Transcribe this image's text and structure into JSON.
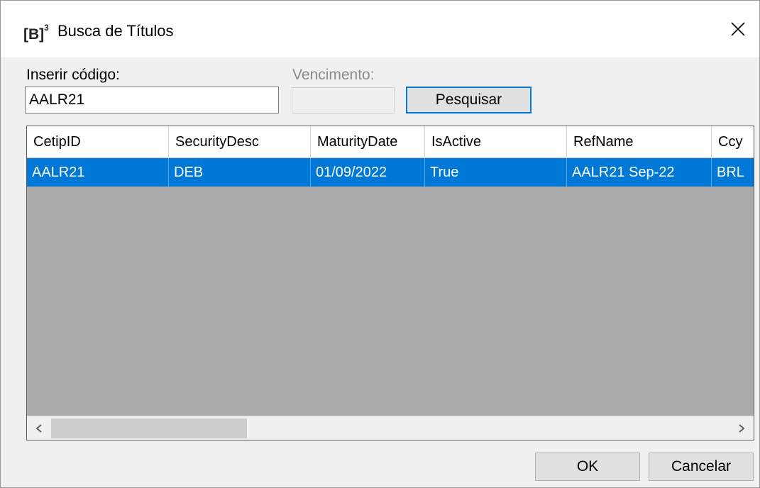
{
  "window": {
    "logo_text": "[B]",
    "logo_mark": "3",
    "title": "Busca de Títulos"
  },
  "form": {
    "code_label": "Inserir código:",
    "code_value": "AALR21",
    "maturity_label": "Vencimento:",
    "maturity_value": "",
    "search_button": "Pesquisar"
  },
  "grid": {
    "columns": [
      "CetipID",
      "SecurityDesc",
      "MaturityDate",
      "IsActive",
      "RefName",
      "Ccy"
    ],
    "rows": [
      [
        "AALR21",
        "DEB",
        "01/09/2022",
        "True",
        "AALR21 Sep-22",
        "BRL"
      ]
    ]
  },
  "footer": {
    "ok_button": "OK",
    "cancel_button": "Cancelar"
  },
  "icons": {
    "close": "close-icon",
    "scroll_left": "chevron-left-icon",
    "scroll_right": "chevron-right-icon"
  },
  "colors": {
    "selection": "#0078d7",
    "grid_background": "#ababab",
    "focus_border": "#0078d7"
  }
}
